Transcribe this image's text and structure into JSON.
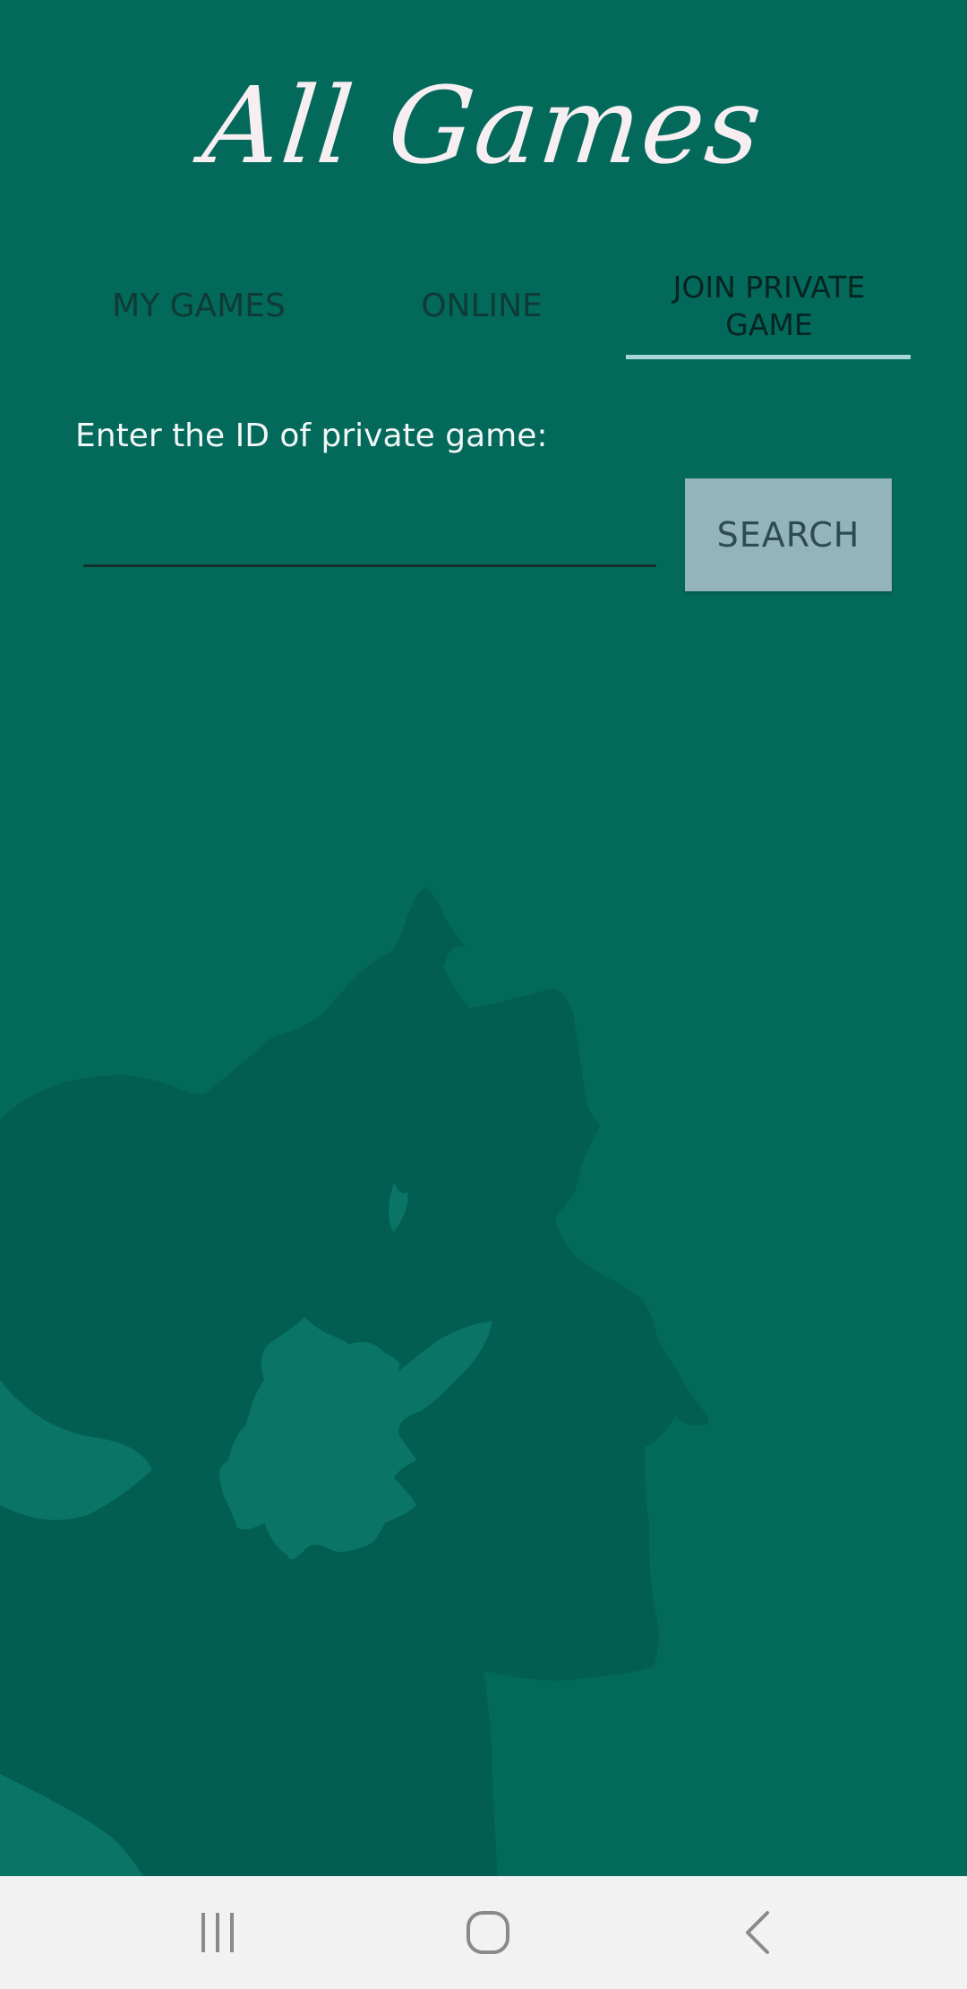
{
  "app": {
    "title": "All Games"
  },
  "tabs": [
    {
      "label": "MY GAMES",
      "active": false
    },
    {
      "label": "ONLINE",
      "active": false
    },
    {
      "label": "JOIN PRIVATE GAME",
      "active": true
    }
  ],
  "join_private": {
    "prompt": "Enter the ID of private game:",
    "input_value": "",
    "search_label": "SEARCH"
  },
  "navbar": {
    "icons": [
      "recent-apps-icon",
      "home-icon",
      "back-icon"
    ]
  },
  "colors": {
    "background": "#03695b",
    "title": "#f7eef2",
    "tab_indicator": "#a8d7da",
    "search_button": "#93b4bb",
    "navbar": "#f2f2f2"
  }
}
